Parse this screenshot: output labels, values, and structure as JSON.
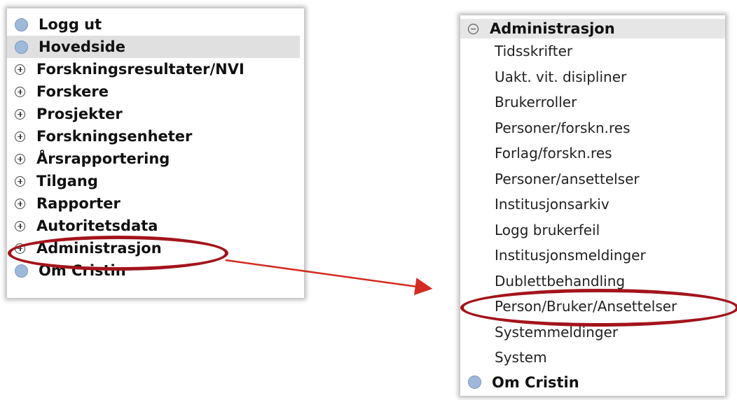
{
  "left_menu": {
    "items": [
      {
        "label": "Logg ut",
        "icon": "bullet-icon"
      },
      {
        "label": "Hovedside",
        "icon": "bullet-icon"
      },
      {
        "label": "Forskningsresultater/NVI",
        "icon": "expand-plus-icon"
      },
      {
        "label": "Forskere",
        "icon": "expand-plus-icon"
      },
      {
        "label": "Prosjekter",
        "icon": "expand-plus-icon"
      },
      {
        "label": "Forskningsenheter",
        "icon": "expand-plus-icon"
      },
      {
        "label": "Årsrapportering",
        "icon": "expand-plus-icon"
      },
      {
        "label": "Tilgang",
        "icon": "expand-plus-icon"
      },
      {
        "label": "Rapporter",
        "icon": "expand-plus-icon"
      },
      {
        "label": "Autoritetsdata",
        "icon": "expand-plus-icon"
      },
      {
        "label": "Administrasjon",
        "icon": "expand-plus-icon"
      },
      {
        "label": "Om Cristin",
        "icon": "bullet-icon"
      }
    ]
  },
  "right_menu": {
    "header": {
      "label": "Administrasjon",
      "icon": "collapse-minus-icon"
    },
    "subitems": [
      "Tidsskrifter",
      "Uakt. vit. disipliner",
      "Brukerroller",
      "Personer/forskn.res",
      "Forlag/forskn.res",
      "Personer/ansettelser",
      "Institusjonsarkiv",
      "Logg brukerfeil",
      "Institusjonsmeldinger",
      "Dublettbehandling",
      "Person/Bruker/Ansettelser",
      "Systemmeldinger",
      "System"
    ],
    "footer": {
      "label": "Om Cristin",
      "icon": "bullet-icon"
    }
  },
  "annotation": {
    "color": "#a3141c",
    "highlight_color": "#e0e0e0",
    "bullet_color": "#9fb9db"
  }
}
